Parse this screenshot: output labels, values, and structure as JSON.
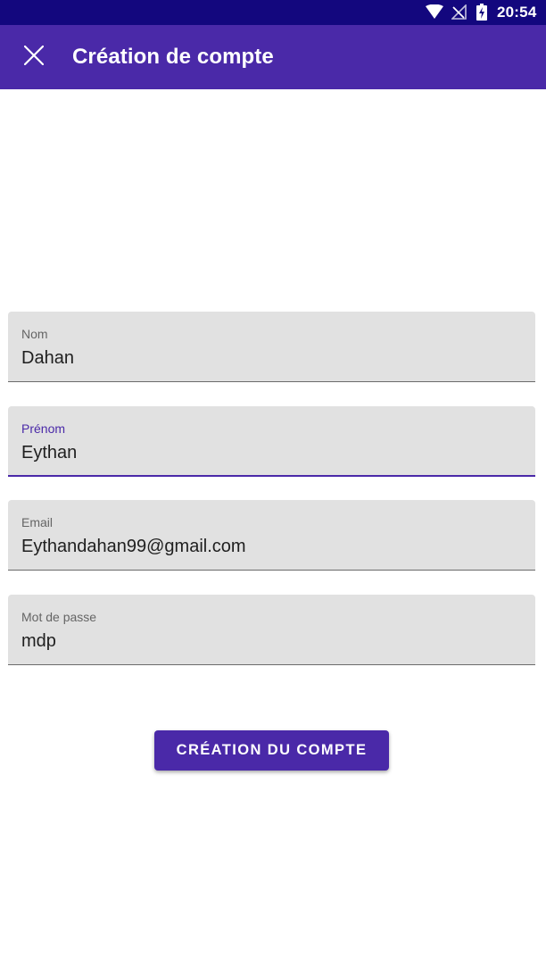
{
  "status_bar": {
    "time": "20:54",
    "icons": [
      "wifi-icon",
      "no-signal-icon",
      "battery-charging-icon"
    ]
  },
  "app_bar": {
    "close_icon": "close-icon",
    "title": "Création de compte"
  },
  "form": {
    "fields": [
      {
        "label": "Nom",
        "value": "Dahan",
        "focused": false
      },
      {
        "label": "Prénom",
        "value": "Eythan",
        "focused": true
      },
      {
        "label": "Email",
        "value": "Eythandahan99@gmail.com",
        "focused": false
      },
      {
        "label": "Mot de passe",
        "value": "mdp",
        "focused": false
      }
    ],
    "submit_label": "CRÉATION DU COMPTE"
  },
  "colors": {
    "status_bar": "#13077e",
    "primary": "#4a29a8",
    "field_background": "#e1e1e1"
  }
}
